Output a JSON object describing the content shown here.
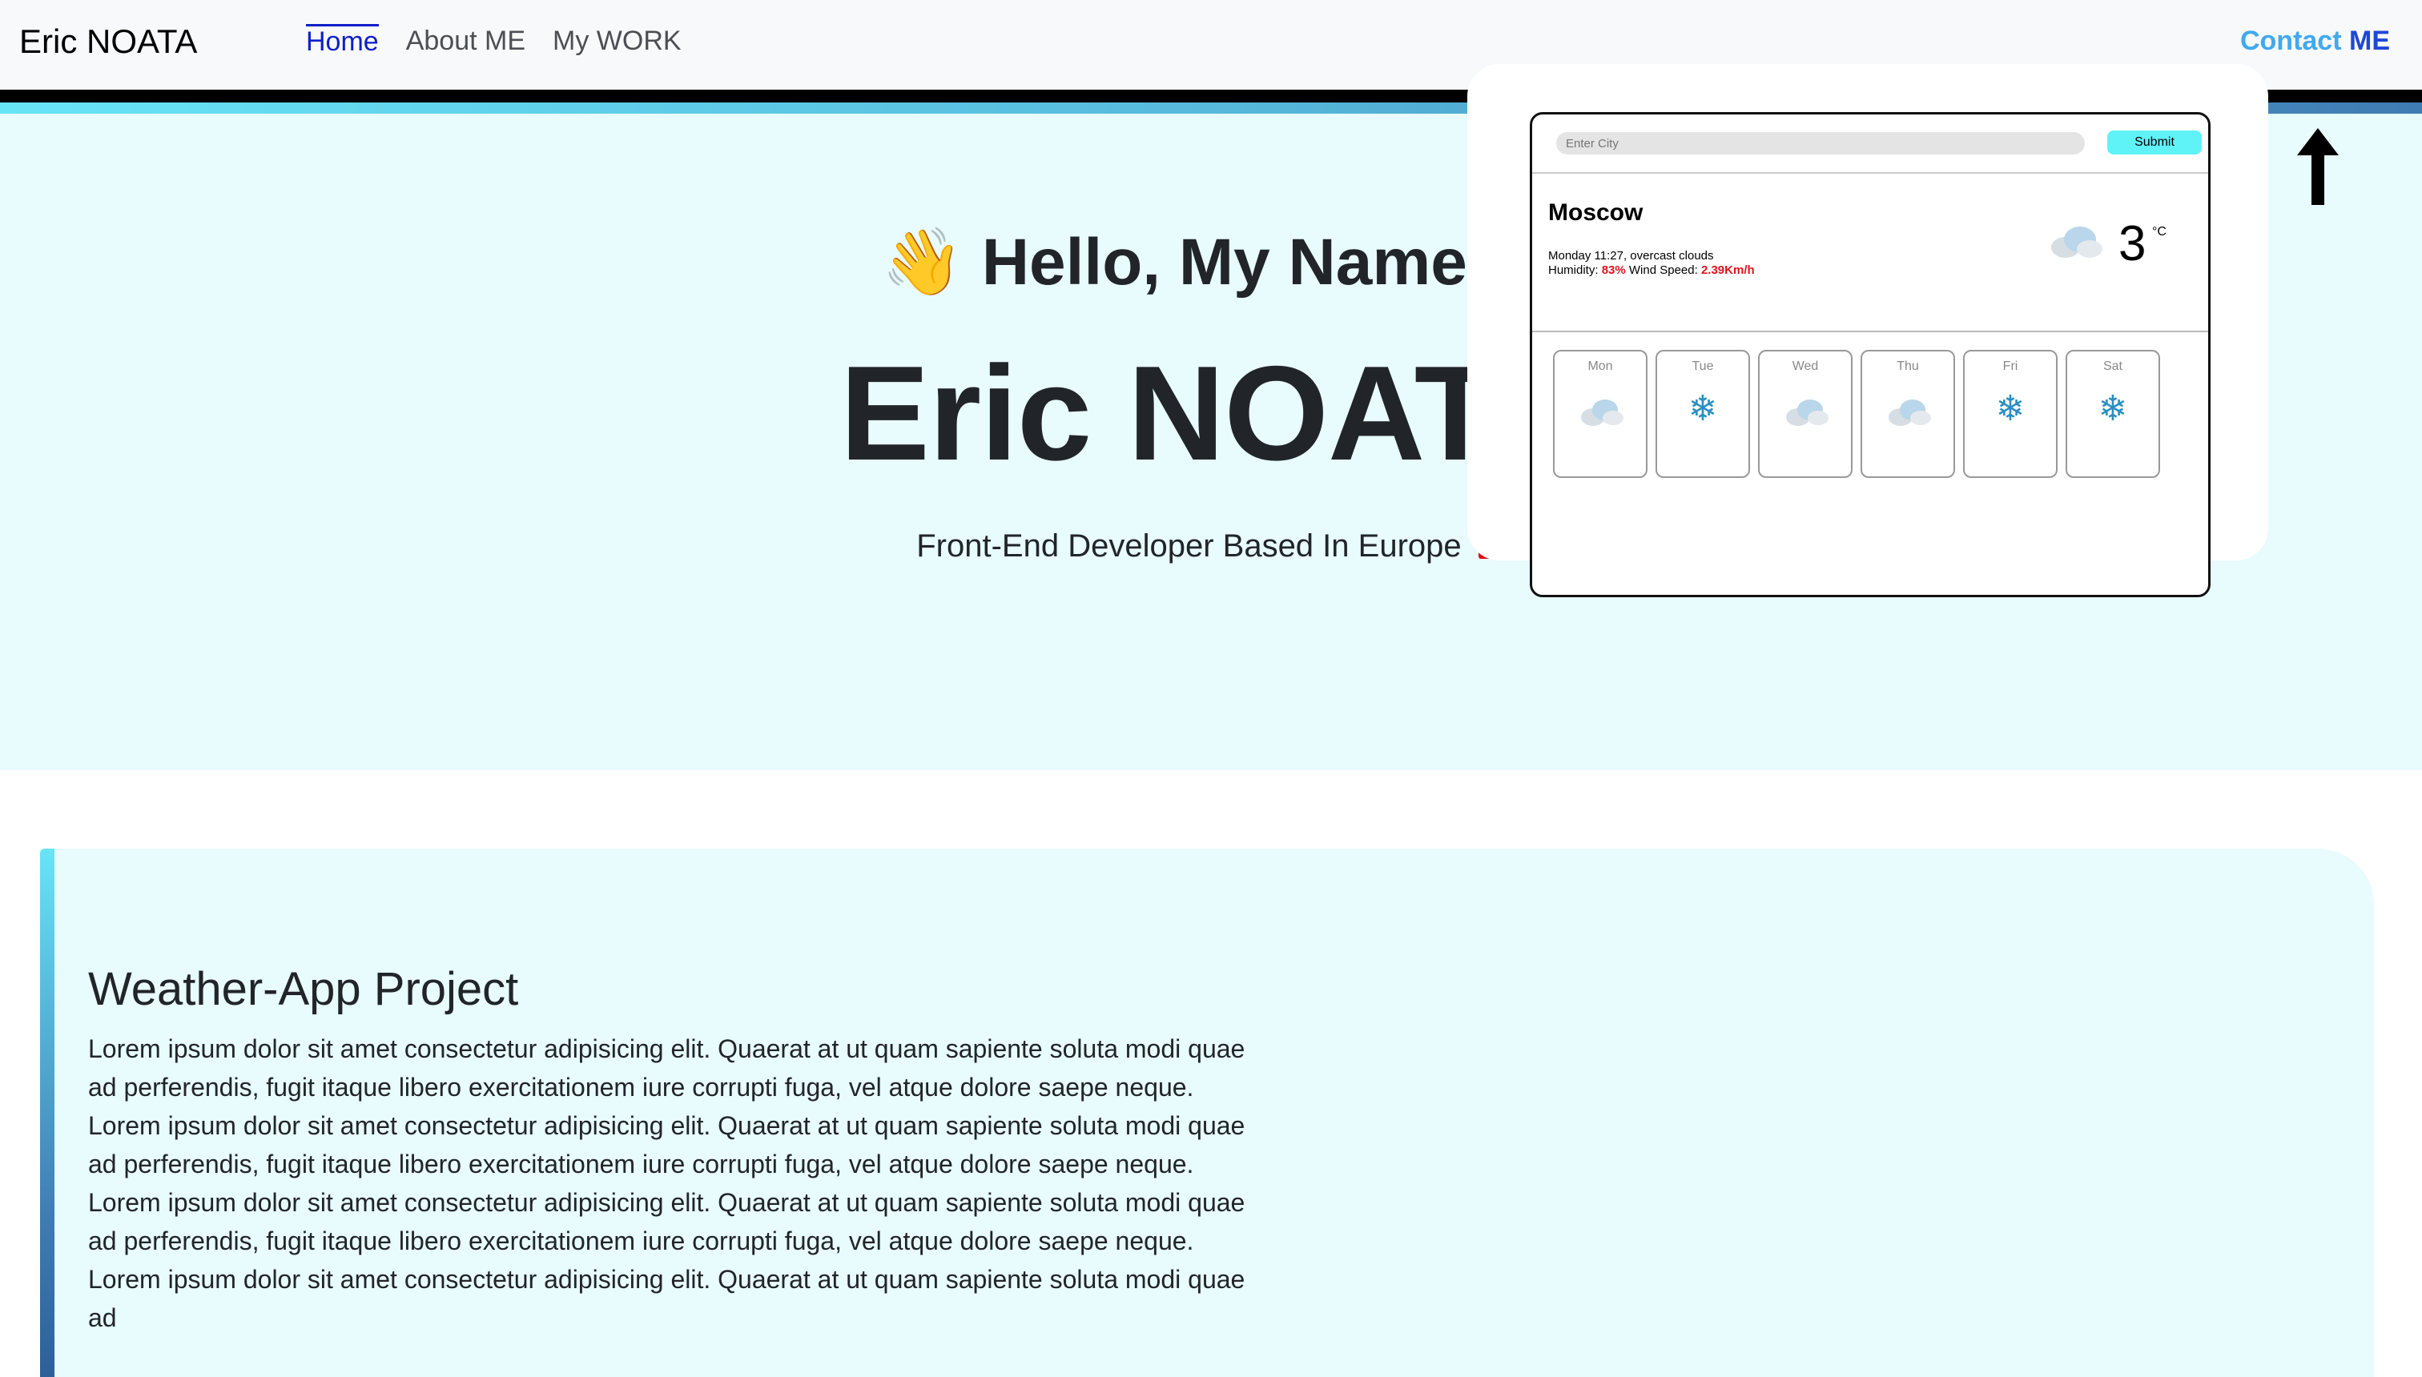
{
  "navbar": {
    "brand": "Eric NOATA",
    "links": [
      {
        "label": "Home",
        "active": true
      },
      {
        "label": "About ME",
        "active": false
      },
      {
        "label": "My WORK",
        "active": false
      }
    ],
    "contact": {
      "part1": "Contact",
      "part2": "ME"
    }
  },
  "hero": {
    "greeting_emoji": "👋",
    "greeting": "Hello, My Name Is",
    "name": "Eric NOATA",
    "subtitle": "Front-End Developer Based In Europe",
    "flag_emoji": "🇹🇷",
    "scroll_icon": "up-arrow-icon"
  },
  "project": {
    "title": "Weather-App Project",
    "description": "Lorem ipsum dolor sit amet consectetur adipisicing elit. Quaerat at ut quam sapiente soluta modi quae ad perferendis, fugit itaque libero exercitationem iure corrupti fuga, vel atque dolore saepe neque. Lorem ipsum dolor sit amet consectetur adipisicing elit. Quaerat at ut quam sapiente soluta modi quae ad perferendis, fugit itaque libero exercitationem iure corrupti fuga, vel atque dolore saepe neque. Lorem ipsum dolor sit amet consectetur adipisicing elit. Quaerat at ut quam sapiente soluta modi quae ad perferendis, fugit itaque libero exercitationem iure corrupti fuga, vel atque dolore saepe neque. Lorem ipsum dolor sit amet consectetur adipisicing elit. Quaerat at ut quam sapiente soluta modi quae ad"
  },
  "weather_preview": {
    "search_placeholder": "Enter City",
    "submit_label": "Submit",
    "city": "Moscow",
    "date_line": "Monday 11:27, overcast clouds",
    "humidity_label": "Humidity:",
    "humidity_value": "83%",
    "wind_label": "Wind Speed:",
    "wind_value": "2.39Km/h",
    "temperature": "3",
    "temperature_unit": "°C",
    "days": [
      {
        "label": "Mon",
        "icon": "cloud-icon"
      },
      {
        "label": "Tue",
        "icon": "snowflake-icon"
      },
      {
        "label": "Wed",
        "icon": "cloud-icon"
      },
      {
        "label": "Thu",
        "icon": "cloud-icon"
      },
      {
        "label": "Fri",
        "icon": "snowflake-icon"
      },
      {
        "label": "Sat",
        "icon": "snowflake-icon"
      }
    ]
  },
  "colors": {
    "accent_blue": "#0d1fc9",
    "contact_light": "#41a9f0",
    "hero_bg": "#e8fbfd",
    "accent_cyan": "#5ff3f7",
    "alert_red": "#e0141e"
  }
}
